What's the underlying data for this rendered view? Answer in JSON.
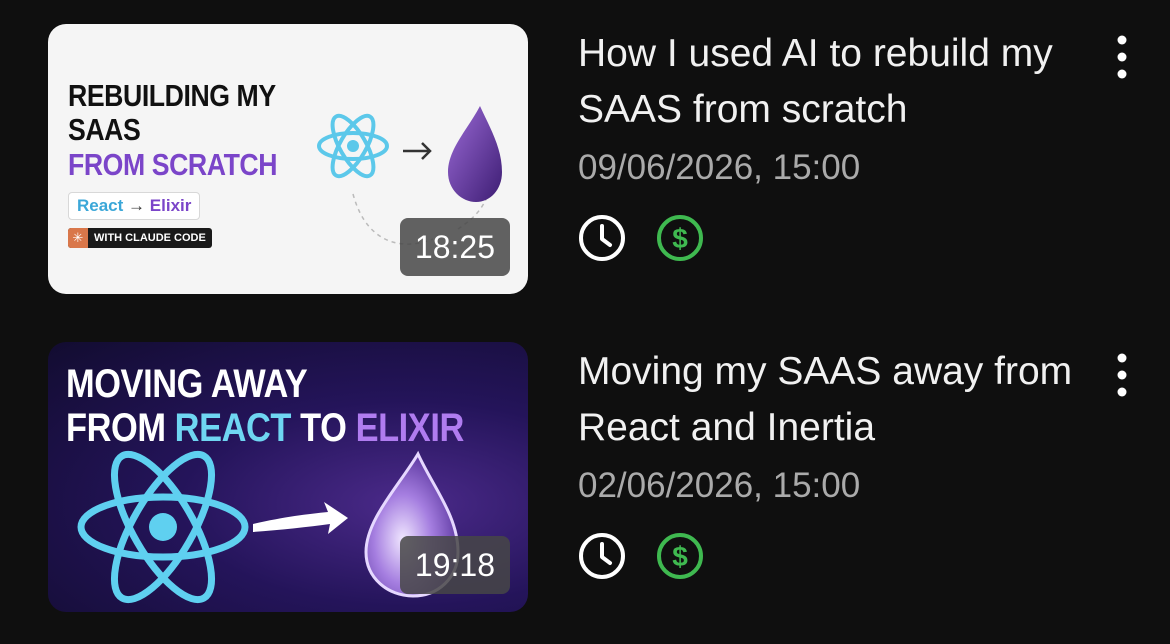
{
  "colors": {
    "background": "#0f0f0f",
    "title": "#f1f1f1",
    "meta": "#aaaaaa",
    "monetized_green": "#3fb950",
    "icon_white": "#ffffff"
  },
  "videos": [
    {
      "title": "How I used AI to rebuild my SAAS from scratch",
      "date": "09/06/2026, 15:00",
      "duration": "18:25",
      "thumbnail": {
        "line1": "REBUILDING MY",
        "line2": "SAAS",
        "line3": "FROM SCRATCH",
        "pill_from": "React",
        "pill_arrow": "→",
        "pill_to": "Elixir",
        "badge_text": "WITH CLAUDE CODE",
        "badge_icon": "claude-spark-icon"
      },
      "status_icons": [
        "clock-icon",
        "dollar-icon"
      ]
    },
    {
      "title": "Moving my SAAS away from React and Inertia",
      "date": "02/06/2026, 15:00",
      "duration": "19:18",
      "thumbnail": {
        "line1": "MOVING AWAY",
        "line2_a": "FROM ",
        "line2_b": "REACT",
        "line2_c": " TO ",
        "line2_d": "ELIXIR"
      },
      "status_icons": [
        "clock-icon",
        "dollar-icon"
      ]
    }
  ]
}
